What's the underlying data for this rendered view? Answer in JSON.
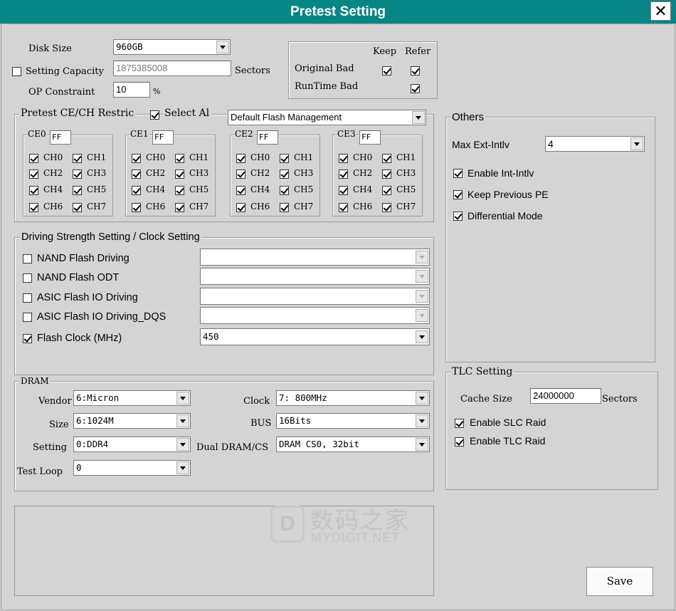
{
  "window": {
    "title": "Pretest Setting",
    "close_glyph": "✕"
  },
  "disk": {
    "disk_size_label": "Disk Size",
    "disk_size_value": "960GB",
    "setting_capacity_label": "Setting Capacity",
    "setting_capacity_checked": false,
    "capacity_value": "1875385008",
    "sectors_label": "Sectors",
    "op_label": "OP Constraint",
    "op_value": "10",
    "op_unit": "%"
  },
  "badblock": {
    "keep_label": "Keep",
    "refer_label": "Refer",
    "rows": [
      {
        "label": "Original Bad",
        "keep": true,
        "refer": true
      },
      {
        "label": "RunTime Bad",
        "keep": null,
        "refer": true
      }
    ]
  },
  "pretest_ce": {
    "title": "Pretest CE/CH Restric",
    "select_all_label": "Select Al",
    "select_all_checked": true,
    "mode_value": "Default Flash Management",
    "ce_groups": [
      {
        "label": "CE0",
        "mask": "FF",
        "channels": [
          "CH0",
          "CH1",
          "CH2",
          "CH3",
          "CH4",
          "CH5",
          "CH6",
          "CH7"
        ]
      },
      {
        "label": "CE1",
        "mask": "FF",
        "channels": [
          "CH0",
          "CH1",
          "CH2",
          "CH3",
          "CH4",
          "CH5",
          "CH6",
          "CH7"
        ]
      },
      {
        "label": "CE2",
        "mask": "FF",
        "channels": [
          "CH0",
          "CH1",
          "CH2",
          "CH3",
          "CH4",
          "CH5",
          "CH6",
          "CH7"
        ]
      },
      {
        "label": "CE3",
        "mask": "FF",
        "channels": [
          "CH0",
          "CH1",
          "CH2",
          "CH3",
          "CH4",
          "CH5",
          "CH6",
          "CH7"
        ]
      }
    ]
  },
  "driving": {
    "title": "Driving Strength Setting / Clock Setting",
    "rows": [
      {
        "label": "NAND Flash Driving",
        "checked": false,
        "value": "",
        "enabled": false
      },
      {
        "label": "NAND Flash ODT",
        "checked": false,
        "value": "",
        "enabled": false
      },
      {
        "label": "ASIC Flash IO Driving",
        "checked": false,
        "value": "",
        "enabled": false
      },
      {
        "label": "ASIC Flash IO Driving_DQS",
        "checked": false,
        "value": "",
        "enabled": false
      },
      {
        "label": "Flash Clock (MHz)",
        "checked": true,
        "value": "450",
        "enabled": true
      }
    ]
  },
  "dram": {
    "title": "DRAM",
    "vendor_label": "Vendor",
    "vendor_value": "6:Micron",
    "size_label": "Size",
    "size_value": "6:1024M",
    "setting_label": "Setting",
    "setting_value": "0:DDR4",
    "test_loop_label": "Test  Loop",
    "test_loop_value": "0",
    "clock_label": "Clock",
    "clock_value": "7: 800MHz",
    "bus_label": "BUS",
    "bus_value": "16Bits",
    "dual_label": "Dual DRAM/CS",
    "dual_value": "DRAM CS0, 32bit"
  },
  "others": {
    "title": "Others",
    "max_label": "Max Ext-Intlv",
    "max_value": "4",
    "options": [
      {
        "label": "Enable Int-Intlv",
        "checked": true
      },
      {
        "label": "Keep Previous PE",
        "checked": true
      },
      {
        "label": "Differential Mode",
        "checked": true
      }
    ]
  },
  "tlc": {
    "title": "TLC  Setting",
    "cache_label": "Cache  Size",
    "cache_value": "24000000",
    "sectors_label": "Sectors",
    "options": [
      {
        "label": "Enable SLC Raid",
        "checked": true
      },
      {
        "label": "Enable TLC Raid",
        "checked": true
      }
    ]
  },
  "watermark": {
    "cn": "数码之家",
    "en": "MYDIGIT.NET",
    "logo": "D"
  },
  "save_label": "Save"
}
